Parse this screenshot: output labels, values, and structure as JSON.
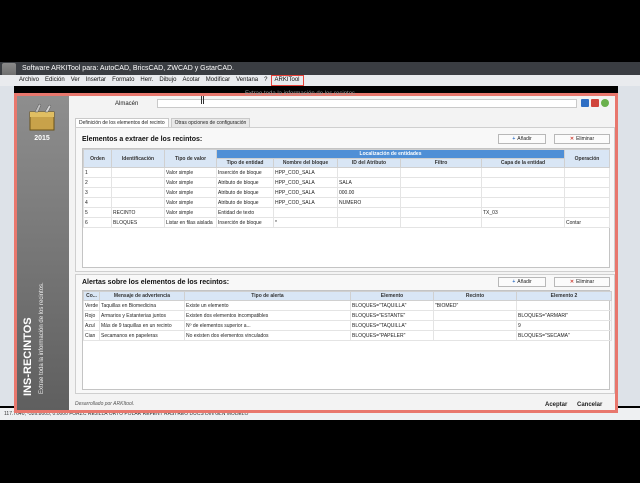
{
  "window": {
    "title": "Software ARKITool para: AutoCAD, BricsCAD, ZWCAD y GstarCAD."
  },
  "menu": [
    "Archivo",
    "Edición",
    "Ver",
    "Insertar",
    "Formato",
    "Herr.",
    "Dibujo",
    "Acotar",
    "Modificar",
    "Ventana",
    "?",
    "ARKITool"
  ],
  "menu_highlight": "ARKITool",
  "cmdline": "117.7640, -326.8005, 0.0000   FORZC  REJILLA  ORTO  POLAR  REFENT  RASTREO  DUCS  DIN  GLN  MODELO",
  "dialog": {
    "ghost_text": "Extrae toda la información de los recintos.",
    "almacen_label": "Almacén",
    "almacen_value": "",
    "logo_year": "2015",
    "side_title": "INS-RECINTOS",
    "side_subtitle": "Extrae toda la información de los recintos.",
    "tabs": [
      "Definición de los elementos del recinto",
      "Otras opciones de configuración"
    ],
    "elementos": {
      "title": "Elementos a extraer de los recintos:",
      "add_label": "Añadir",
      "delete_label": "Eliminar",
      "group_header": "Localización de entidades",
      "columns": [
        "Orden",
        "Identificación",
        "Tipo de valor",
        "Tipo de entidad",
        "Nombre del bloque",
        "ID del Atributo",
        "Filtro",
        "Capa de la entidad",
        "Operación"
      ],
      "rows": [
        [
          "1",
          "",
          "Valor simple",
          "Inserción de bloque",
          "HPP_COD_SALA",
          "",
          "",
          "",
          ""
        ],
        [
          "2",
          "",
          "Valor simple",
          "Atributo de bloque",
          "HPP_COD_SALA",
          "SALA",
          "",
          "",
          ""
        ],
        [
          "3",
          "",
          "Valor simple",
          "Atributo de bloque",
          "HPP_COD_SALA",
          "000.00",
          "",
          "",
          ""
        ],
        [
          "4",
          "",
          "Valor simple",
          "Atributo de bloque",
          "HPP_COD_SALA",
          "NUMERO",
          "",
          "",
          ""
        ],
        [
          "5",
          "RECINTO",
          "Valor simple",
          "Entidad de texto",
          "",
          "",
          "",
          "TX_03",
          ""
        ],
        [
          "6",
          "BLOQUES",
          "Listar en filas aislada",
          "Inserción de bloque",
          "*",
          "",
          "",
          "",
          "Contar"
        ]
      ]
    },
    "alertas": {
      "title": "Alertas sobre los elementos de los recintos:",
      "add_label": "Añadir",
      "delete_label": "Eliminar",
      "columns": [
        "Co...",
        "Mensaje de advertencia",
        "Tipo de alerta",
        "Elemento",
        "Recinto",
        "Elemento 2"
      ],
      "rows": [
        [
          "Verde",
          "Taquillas en Biomedicina",
          "Existe un elemento",
          "BLOQUES=\"TAQUILLA\"",
          "\"BIOMED\"",
          ""
        ],
        [
          "Rojo",
          "Armarios y Estanterias juntos",
          "Existen dos elementos incompatibles",
          "BLOQUES=\"ESTANTE\"",
          "",
          "BLOQUES=\"ARMARI\""
        ],
        [
          "Azul",
          "Más de 9 taquillas en un recinto",
          "Nº de elementos superior a...",
          "BLOQUES=\"TAQUILLA\"",
          "",
          "9"
        ],
        [
          "Cian",
          "Secamanos en papeleras",
          "No existen dos elementos vinculados",
          "BLOQUES=\"PAPELER\"",
          "",
          "BLOQUES=\"SECAMA\""
        ]
      ]
    },
    "footer": {
      "credit": "Desarrollado por ARKItool.",
      "accept": "Aceptar",
      "cancel": "Cancelar"
    }
  },
  "colors": {
    "accent_border": "#e8776d",
    "header_blue": "#d9e6f5",
    "group_blue": "#4f8fd6"
  }
}
